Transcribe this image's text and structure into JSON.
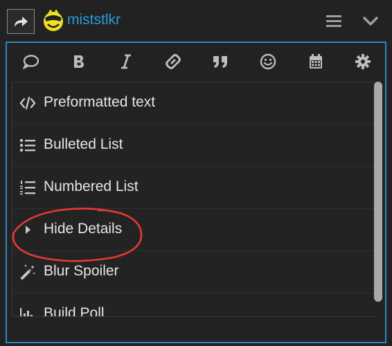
{
  "header": {
    "username": "miststlkr",
    "icons": [
      "reply-arrow-icon",
      "avatar-emoji-icon",
      "hamburger-icon",
      "chevron-down-icon"
    ]
  },
  "toolbar": {
    "buttons": [
      {
        "name": "quote-bubble-icon"
      },
      {
        "name": "bold-icon"
      },
      {
        "name": "italic-icon"
      },
      {
        "name": "link-icon"
      },
      {
        "name": "blockquote-icon"
      },
      {
        "name": "emoji-icon"
      },
      {
        "name": "calendar-icon"
      },
      {
        "name": "gear-icon"
      }
    ]
  },
  "menu": {
    "items": [
      {
        "label": "Preformatted text",
        "icon": "code-icon"
      },
      {
        "label": "Bulleted List",
        "icon": "bulleted-list-icon"
      },
      {
        "label": "Numbered List",
        "icon": "numbered-list-icon"
      },
      {
        "label": "Hide Details",
        "icon": "caret-right-icon"
      },
      {
        "label": "Blur Spoiler",
        "icon": "magic-wand-icon"
      },
      {
        "label": "Build Poll",
        "icon": "poll-chart-icon"
      }
    ]
  },
  "colors": {
    "accent": "#2c9bd6",
    "editor_border": "#2e86c1",
    "annotation": "#e53935",
    "background": "#222222"
  }
}
